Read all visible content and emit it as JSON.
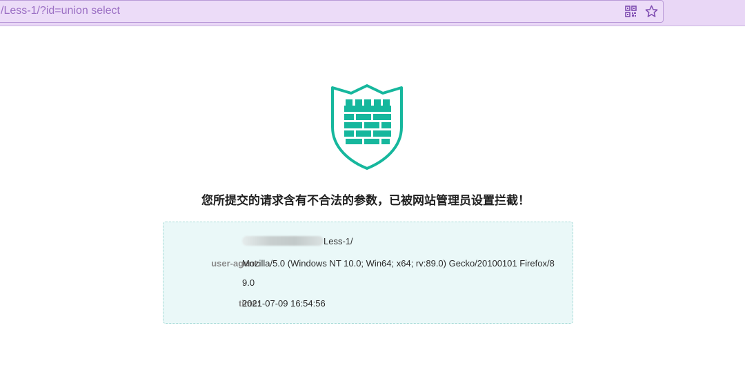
{
  "browser": {
    "address": "/Less-1/?id=union select",
    "icons": [
      "qr-code-icon",
      "star-icon"
    ]
  },
  "waf": {
    "icon": "shield-castle-icon",
    "accent_color": "#16b79d",
    "message": "您所提交的请求含有不合法的参数，已被网站管理员设置拦截！",
    "details": {
      "url_label": "url:",
      "url_value": "Less-1/",
      "ua_label": "user-agent:",
      "ua_value": "Mozilla/5.0 (Windows NT 10.0; Win64; x64; rv:89.0) Gecko/20100101 Firefox/89.0",
      "time_label": "time:",
      "time_value": "2021-07-09 16:54:56"
    }
  }
}
